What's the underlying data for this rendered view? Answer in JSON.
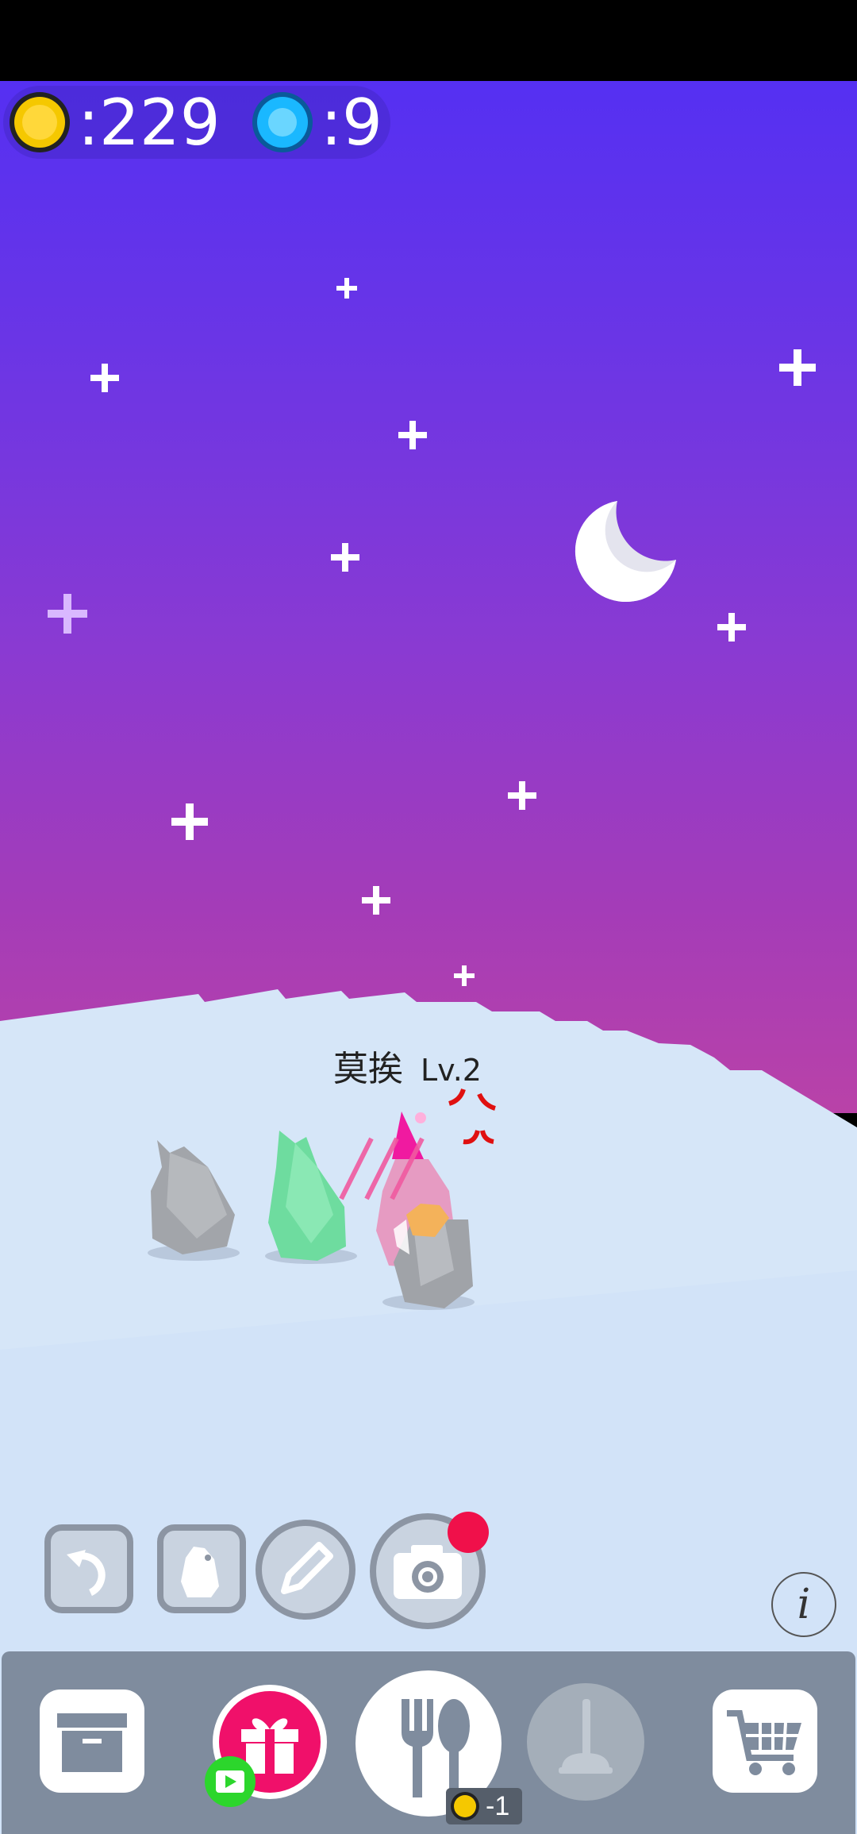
{
  "status_bar": {},
  "currency": {
    "coins": ":229",
    "gems": ":9",
    "coin_color": "#f5c800",
    "gem_color": "#1ab8ff"
  },
  "character": {
    "name": "莫挨",
    "level": "Lv.2"
  },
  "tools": [
    {
      "name": "rotate",
      "icon": "rotate-icon"
    },
    {
      "name": "penguin",
      "icon": "penguin-icon"
    },
    {
      "name": "edit",
      "icon": "pencil-icon"
    },
    {
      "name": "camera",
      "icon": "camera-icon",
      "badge": true
    }
  ],
  "info": {
    "label": "i"
  },
  "bottom_bar": {
    "items": [
      {
        "name": "storage",
        "icon": "box-icon"
      },
      {
        "name": "gift",
        "icon": "gift-icon"
      },
      {
        "name": "feed",
        "icon": "fork-spoon-icon"
      },
      {
        "name": "plunger",
        "icon": "plunger-icon",
        "disabled": true
      },
      {
        "name": "shop",
        "icon": "cart-icon"
      }
    ],
    "feed_cost": "-1"
  },
  "colors": {
    "sky_top": "#5530f2",
    "sky_bottom": "#b942a8",
    "snow": "#d8e8fa",
    "bar": "#7f8c9e",
    "gift_pink": "#f0106a",
    "play_green": "#2cd62c",
    "badge_red": "#f0104a"
  }
}
